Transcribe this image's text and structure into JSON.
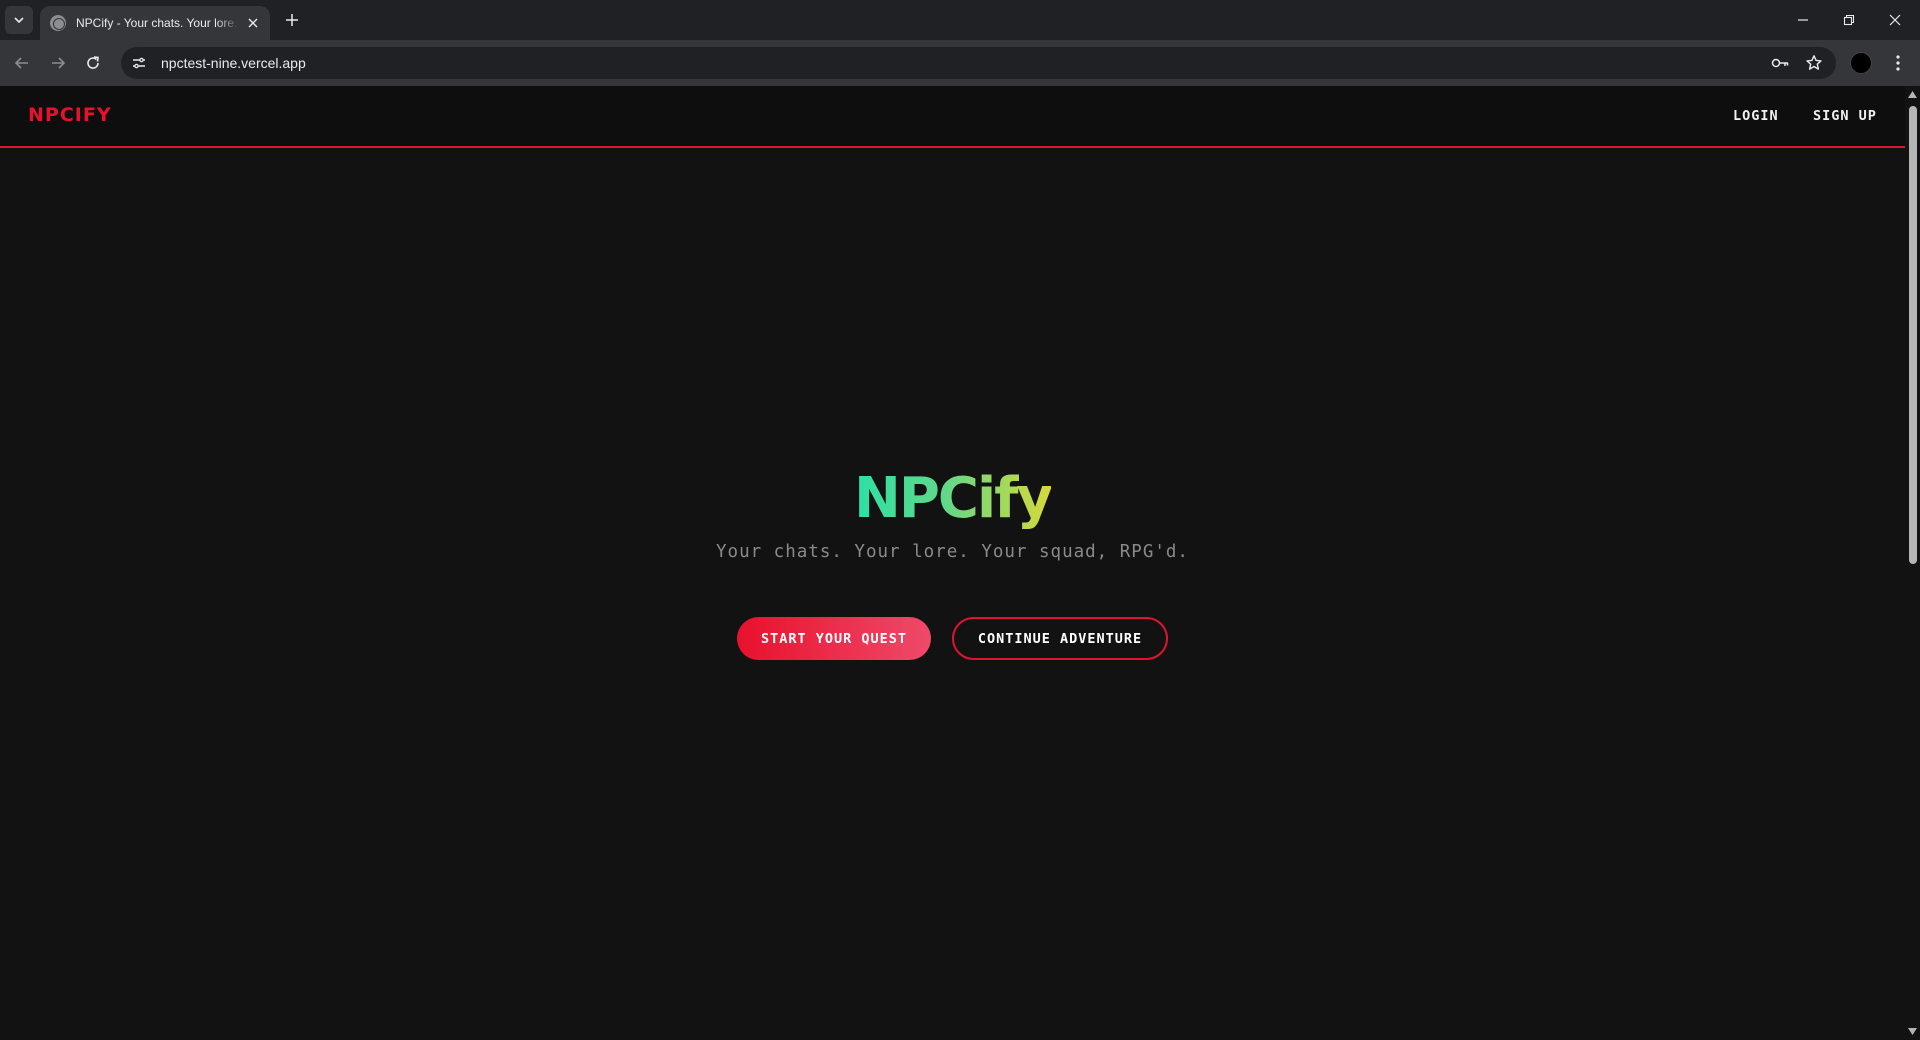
{
  "browser": {
    "tab": {
      "title": "NPCify - Your chats. Your lore. Your squad, RPG'd.",
      "favicon": "globe-icon"
    },
    "address_bar": {
      "url": "npctest-nine.vercel.app"
    },
    "icons": {
      "password": "key-icon",
      "bookmark": "star-icon",
      "menu": "kebab-menu-icon"
    }
  },
  "site": {
    "brand": "NPCIFY",
    "nav": {
      "login": "LOGIN",
      "signup": "SIGN UP"
    },
    "hero": {
      "title": "NPCify",
      "tagline": "Your chats. Your lore. Your squad, RPG'd.",
      "primary_cta": "START YOUR QUEST",
      "secondary_cta": "CONTINUE ADVENTURE"
    }
  },
  "colors": {
    "accent_red": "#e8112d",
    "background": "#121212",
    "title_gradient_start": "#2de0a5",
    "title_gradient_end": "#d6d93a",
    "tagline": "#8a8a8a"
  }
}
